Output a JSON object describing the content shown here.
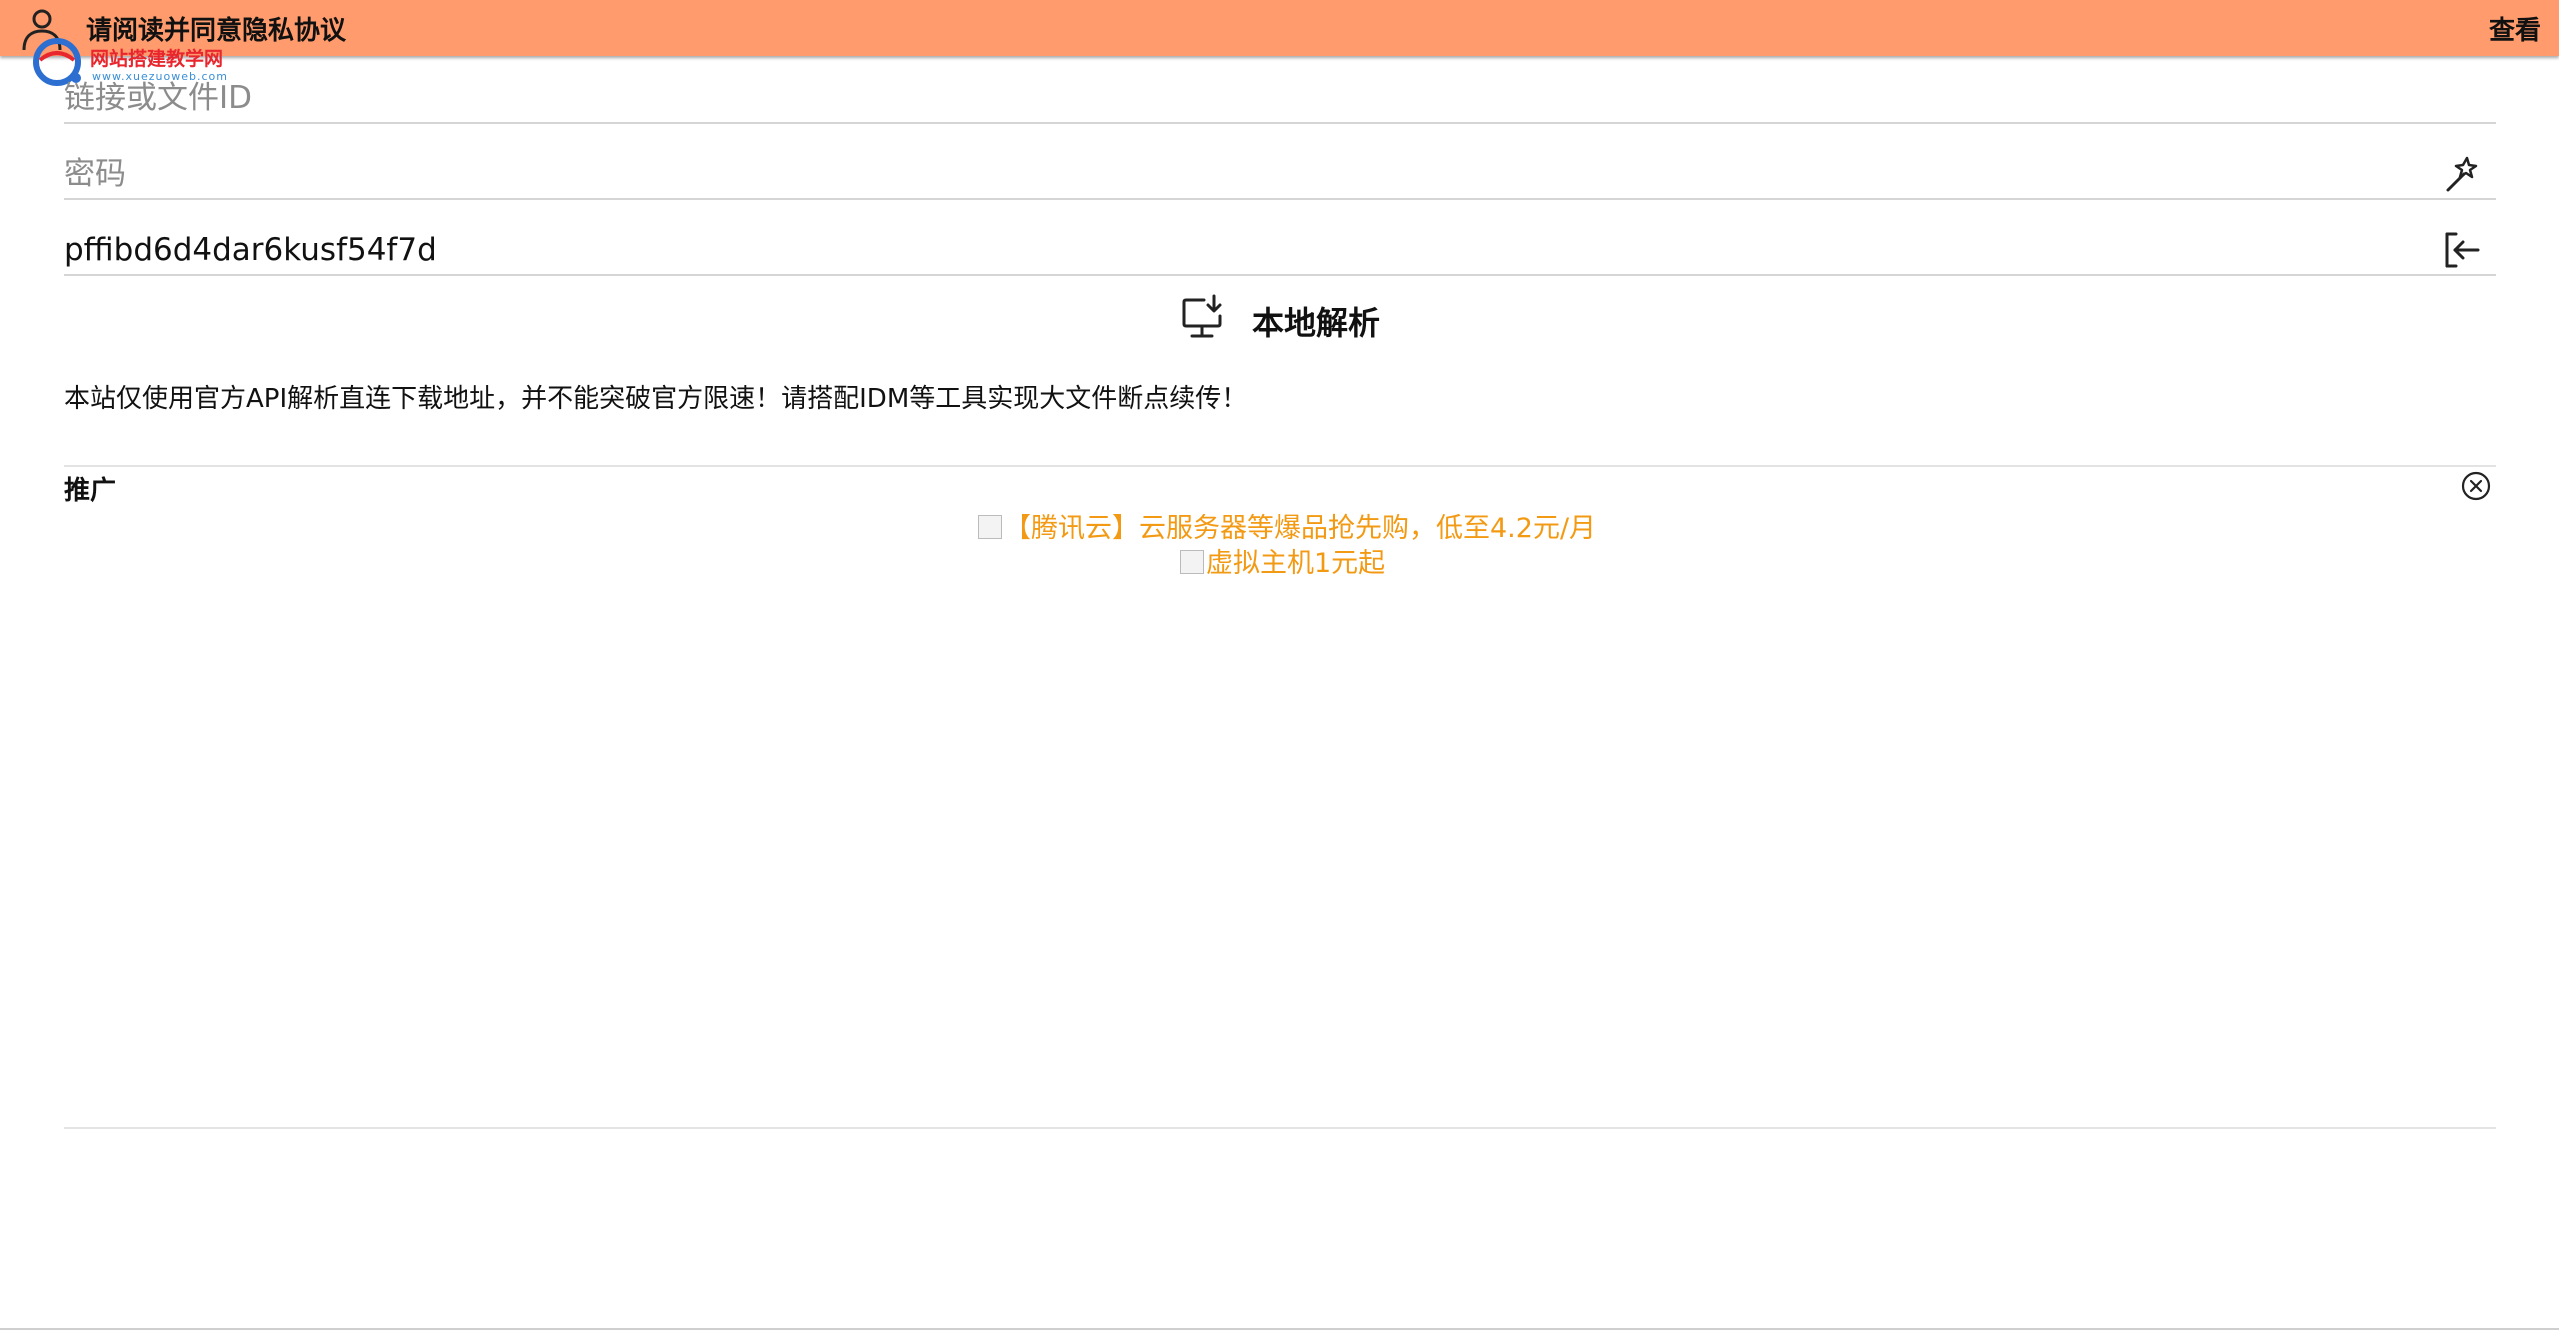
{
  "header": {
    "notice_text": "请阅读并同意隐私协议",
    "view_label": "查看",
    "bar_color": "#ff9b6c"
  },
  "watermark": {
    "text": "网站搭建教学网",
    "url_text": "www.xuezuoweb.com"
  },
  "form": {
    "link_placeholder": "链接或文件ID",
    "password_placeholder": "密码",
    "code_value": "pffibd6d4dar6kusf54f7d"
  },
  "parse_button": {
    "label": "本地解析",
    "icon": "monitor-download-icon"
  },
  "disclaimer": "本站仅使用官方API解析直连下载地址，并不能突破官方限速！请搭配IDM等工具实现大文件断点续传！",
  "promo": {
    "title": "推广",
    "ads": [
      {
        "text": "【腾讯云】云服务器等爆品抢先购，低至4.2元/月"
      },
      {
        "text": "虚拟主机1元起"
      }
    ],
    "link_color": "#f39a14"
  },
  "icons": {
    "user": "user-icon",
    "magic": "magic-wand-icon",
    "login": "login-icon",
    "close": "close-circle-icon"
  }
}
